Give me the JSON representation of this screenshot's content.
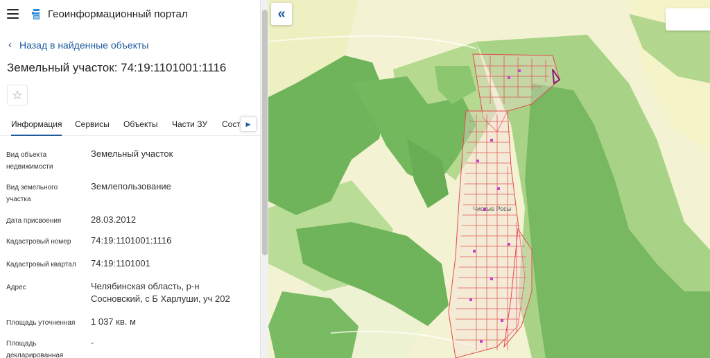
{
  "header": {
    "menu_icon": "hamburger-icon",
    "logo_icon": "portal-logo-icon",
    "title": "Геоинформационный портал"
  },
  "nav": {
    "back_label": "Назад в найденные объекты"
  },
  "object": {
    "title": "Земельный участок: 74:19:1101001:1116",
    "favorite_icon": "star-icon"
  },
  "tabs": [
    {
      "label": "Информация",
      "active": true
    },
    {
      "label": "Сервисы"
    },
    {
      "label": "Объекты"
    },
    {
      "label": "Части ЗУ"
    },
    {
      "label": "Состав"
    }
  ],
  "fields": [
    {
      "label": "Вид объекта недвижимости",
      "value": "Земельный участок"
    },
    {
      "label": "Вид земельного участка",
      "value": "Землепользование"
    },
    {
      "label": "Дата присвоения",
      "value": "28.03.2012"
    },
    {
      "label": "Кадастровый номер",
      "value": "74:19:1101001:1116"
    },
    {
      "label": "Кадастровый квартал",
      "value": "74:19:1101001"
    },
    {
      "label": "Адрес",
      "value": "Челябинская область, р-н Сосновский, с Б Харлуши, уч 202"
    },
    {
      "label": "Площадь уточненная",
      "value": "1 037 кв. м"
    },
    {
      "label": "Площадь декларированная",
      "value": "-"
    }
  ],
  "map": {
    "place_label": "Чистые Росы",
    "collapse_icon": "double-chevron-left-icon",
    "colors": {
      "forest": "#6fb35a",
      "light_forest": "#a9d48a",
      "field": "#f2f2c6",
      "parcels": "#e34b4b",
      "highlight": "#8a1a7a",
      "accent": "#1f5a9e"
    }
  }
}
